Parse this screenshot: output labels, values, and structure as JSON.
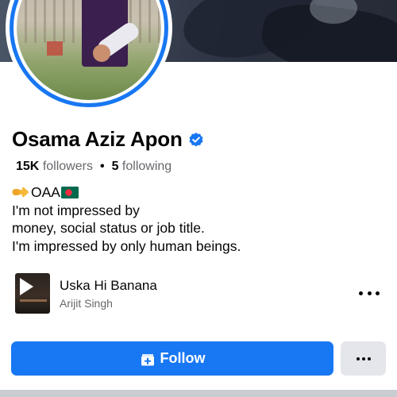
{
  "profile": {
    "name": "Osama Aziz Apon",
    "verified": true,
    "followers_count": "15K",
    "followers_label": "followers",
    "following_count": "5",
    "following_label": "following"
  },
  "bio": {
    "line1_text": "OAA",
    "line1_prefix_emoji": "pointing-right-emoji",
    "line1_suffix_emoji": "bangladesh-flag-emoji",
    "line2": "I'm not impressed by",
    "line3": "money, social status or job title.",
    "line4": "I'm impressed by only human beings."
  },
  "music": {
    "song": "Uska Hi Banana",
    "artist": "Arijit Singh"
  },
  "actions": {
    "follow_label": "Follow"
  },
  "colors": {
    "accent": "#1877f2",
    "secondary_button": "#e4e6eb",
    "muted_text": "#65676b",
    "flag_green": "#006a4e",
    "flag_red": "#f42a41"
  }
}
